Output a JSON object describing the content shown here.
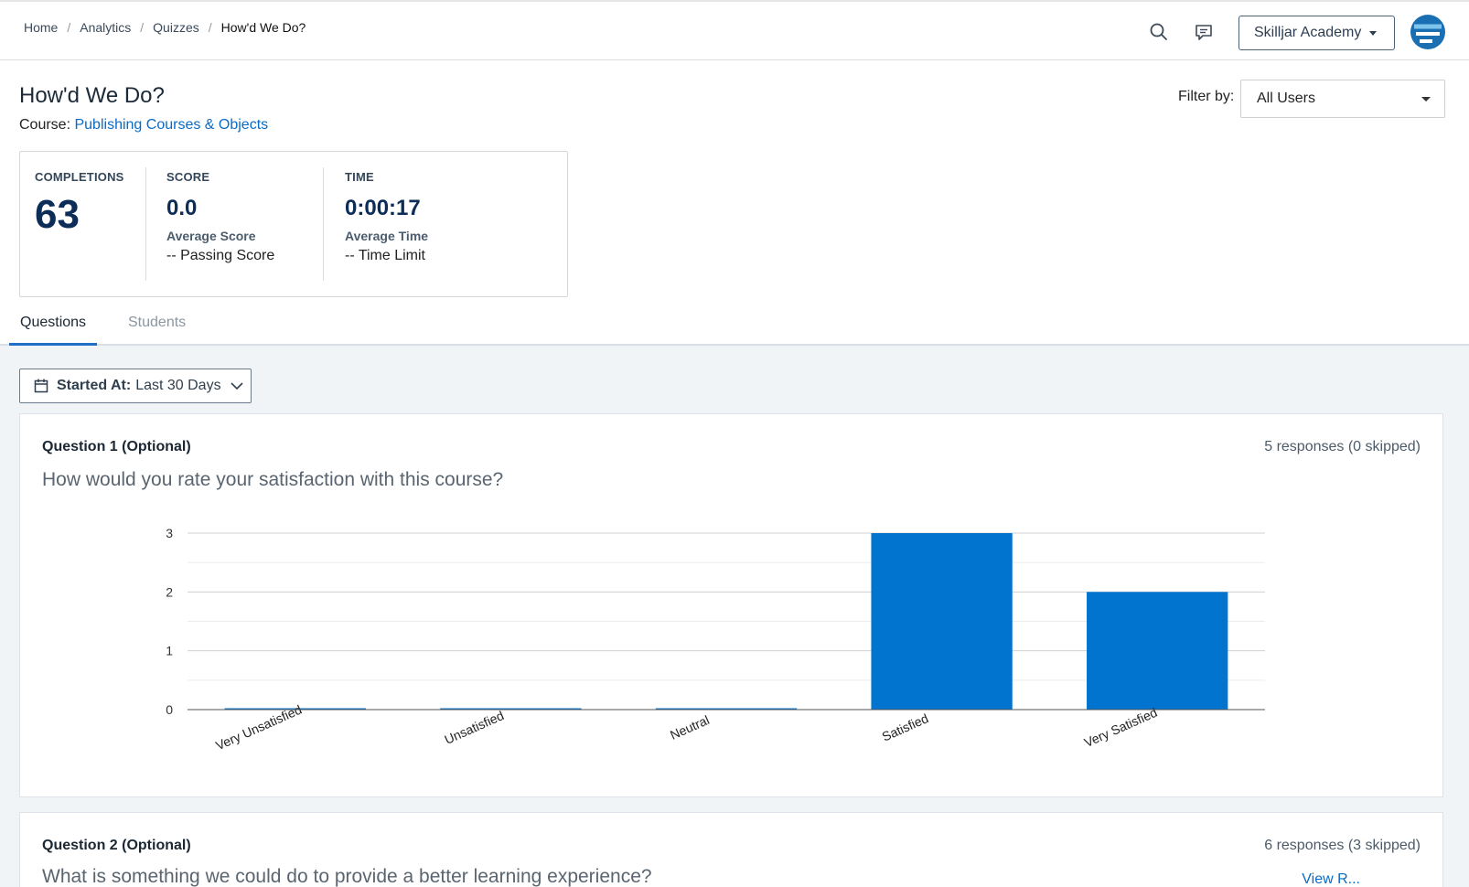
{
  "breadcrumb": {
    "items": [
      "Home",
      "Analytics",
      "Quizzes"
    ],
    "separator": "/",
    "current": "How'd We Do?"
  },
  "topbar": {
    "search_icon": "search-icon",
    "message_icon": "chat-bubble-icon",
    "org_label": "Skilljar Academy",
    "avatar_icon": "avatar-logo-icon"
  },
  "header": {
    "title": "How'd We Do?",
    "course_label": "Course:",
    "course_link": "Publishing Courses & Objects",
    "filter_label": "Filter by:",
    "filter_value": "All Users"
  },
  "stats": {
    "completions": {
      "label": "COMPLETIONS",
      "value": "63"
    },
    "score": {
      "label": "SCORE",
      "value": "0.0",
      "sub": "Average Score",
      "sub2": "-- Passing Score"
    },
    "time": {
      "label": "TIME",
      "value": "0:00:17",
      "sub": "Average Time",
      "sub2": "-- Time Limit"
    }
  },
  "tabs": [
    {
      "label": "Questions",
      "active": true
    },
    {
      "label": "Students",
      "active": false
    }
  ],
  "date_filter": {
    "label": "Started At:",
    "value": "Last 30 Days",
    "icon": "calendar-icon"
  },
  "questions": [
    {
      "title": "Question 1 (Optional)",
      "responses": "5 responses (0 skipped)",
      "text": "How would you rate your satisfaction with this course?"
    },
    {
      "title": "Question 2 (Optional)",
      "responses": "6 responses (3 skipped)",
      "text": "What is something we could do to provide a better learning experience?",
      "link": "View R..."
    }
  ],
  "colors": {
    "bar": "#0174d0",
    "accent": "#1f6fc6",
    "link": "#0a6bc7",
    "stat_value": "#0c2d57"
  },
  "chart_data": {
    "type": "bar",
    "title": "",
    "xlabel": "",
    "ylabel": "",
    "categories": [
      "Very Unsatisfied",
      "Unsatisfied",
      "Neutral",
      "Satisfied",
      "Very Satisfied"
    ],
    "values": [
      0,
      0,
      0,
      3,
      2
    ],
    "ylim": [
      0,
      3
    ],
    "yticks": [
      0,
      1,
      2,
      3
    ],
    "grid": true
  }
}
